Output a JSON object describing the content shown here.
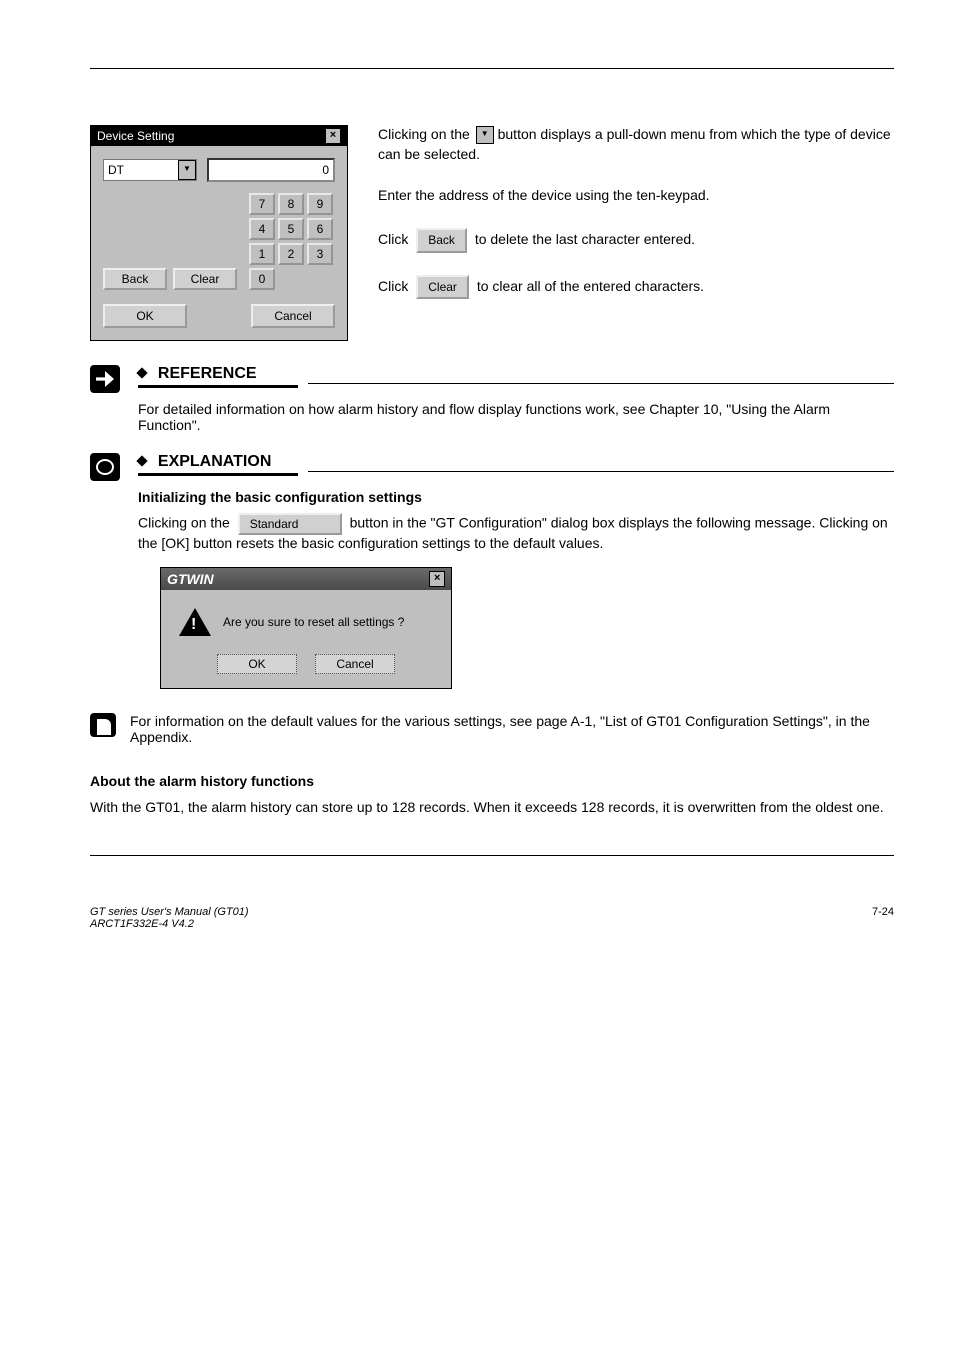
{
  "dialog": {
    "title": "Device Setting",
    "combo_value": "DT",
    "input_value": "0",
    "keys": [
      "7",
      "8",
      "9",
      "4",
      "5",
      "6",
      "1",
      "2",
      "3",
      "0"
    ],
    "back": "Back",
    "clear": "Clear",
    "ok": "OK",
    "cancel": "Cancel"
  },
  "right": {
    "p1a": "Clicking on the",
    "p1b": "button displays a pull-down menu from which the type of device can be selected.",
    "p2": "Enter the address of the device using the ten-keypad.",
    "p3a": "Click",
    "p3b": "to delete the last character entered.",
    "p4a": "Click",
    "p4b": "to clear all of the entered characters."
  },
  "buttons": {
    "back": "Back",
    "clear": "Clear",
    "standard": "Standard"
  },
  "ref": {
    "heading": "REFERENCE",
    "body": "For detailed information on how alarm history and flow display functions work, see Chapter 10, \"Using the Alarm Function\"."
  },
  "exp": {
    "heading": "EXPLANATION",
    "p1": "Initializing the basic configuration settings",
    "p2a": "Clicking on the",
    "p2b": "button in the \"GT Configuration\" dialog box displays the following message. Clicking on the [OK] button resets the basic configuration settings to the default values."
  },
  "gtwin": {
    "title": "GTWIN",
    "msg": "Are you sure to reset all settings ?",
    "ok": "OK",
    "cancel": "Cancel"
  },
  "bottom": {
    "p1": "For information on the default values for the various settings, see page A-1, \"List of GT01 Configuration Settings\", in the Appendix."
  },
  "feature": {
    "heading": "About the alarm history functions",
    "body": "With the GT01, the alarm history can store up to 128 records. When it exceeds 128 records, it is overwritten from the oldest one."
  },
  "footer": {
    "left": "GT series User's Manual (GT01)\nARCT1F332E-4 V4.2",
    "right": "7-24"
  }
}
